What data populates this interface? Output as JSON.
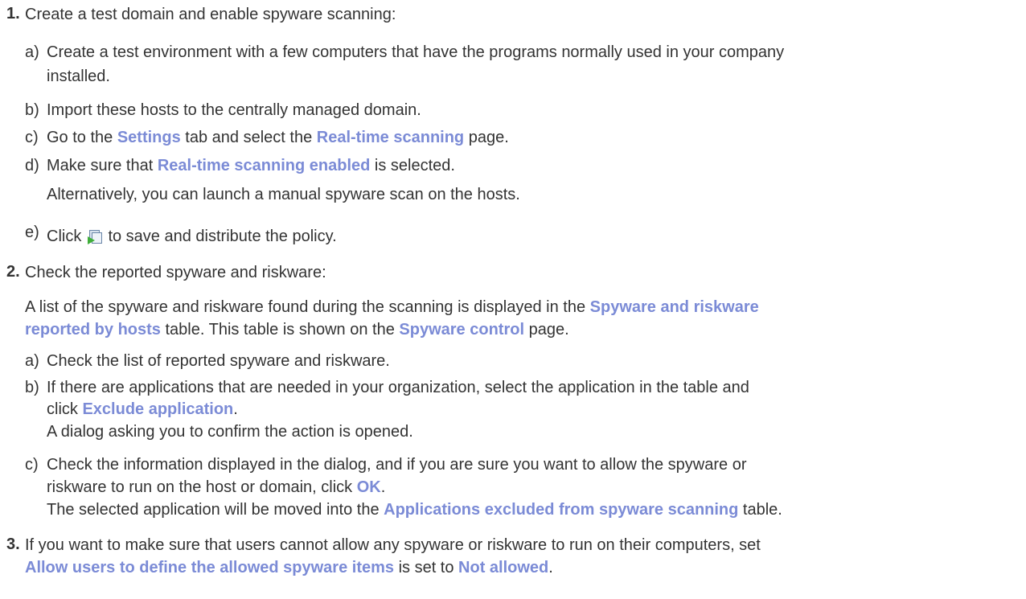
{
  "steps": [
    {
      "num": "1.",
      "text": "Create a test domain and enable spyware scanning:",
      "sub": [
        {
          "letter": "a)",
          "l1": "Create a test environment with a few computers that have the programs normally used in your company",
          "l2": "installed."
        },
        {
          "letter": "b)",
          "text": "Import these hosts to the centrally managed domain."
        },
        {
          "letter": "c)",
          "pre": "Go to the ",
          "u1": "Settings",
          "mid": " tab and select the ",
          "u2": "Real-time scanning",
          "post": " page."
        },
        {
          "letter": "d)",
          "pre": "Make sure that ",
          "u1": "Real-time scanning enabled",
          "post": " is selected.",
          "note": "Alternatively, you can launch a manual spyware scan on the hosts."
        },
        {
          "letter": "e)",
          "pre": "Click ",
          "icon": "save-distribute-icon",
          "post": " to save and distribute the policy."
        }
      ]
    },
    {
      "num": "2.",
      "text": "Check the reported spyware and riskware:",
      "para": {
        "pre": "A list of the spyware and riskware found during the scanning is displayed in the ",
        "u1a": "Spyware and riskware",
        "u1b": "reported by hosts",
        "mid": " table. This table is shown on the ",
        "u2": "Spyware control",
        "post": " page."
      },
      "sub": [
        {
          "letter": "a)",
          "text": "Check the list of reported spyware and riskware."
        },
        {
          "letter": "b)",
          "l1": "If there are applications that are needed in your organization, select the application in the table and",
          "l2pre": "click ",
          "u1": "Exclude application",
          "l2post": ".",
          "note": "A dialog asking you to confirm the action is opened."
        },
        {
          "letter": "c)",
          "l1": "Check the information displayed in the dialog, and if you are sure you want to allow the spyware or",
          "l2pre": "riskware to run on the host or domain, click ",
          "u1": "OK",
          "l2post": ".",
          "note_pre": "The selected application will be moved into the ",
          "note_u": "Applications excluded from spyware scanning",
          "note_post": " table."
        }
      ]
    },
    {
      "num": "3.",
      "l1": "If you want to make sure that users cannot allow any spyware or riskware to run on their computers, set",
      "u1": "Allow users to define the allowed spyware items",
      "mid": " is set to ",
      "u2": "Not allowed",
      "post": "."
    }
  ]
}
